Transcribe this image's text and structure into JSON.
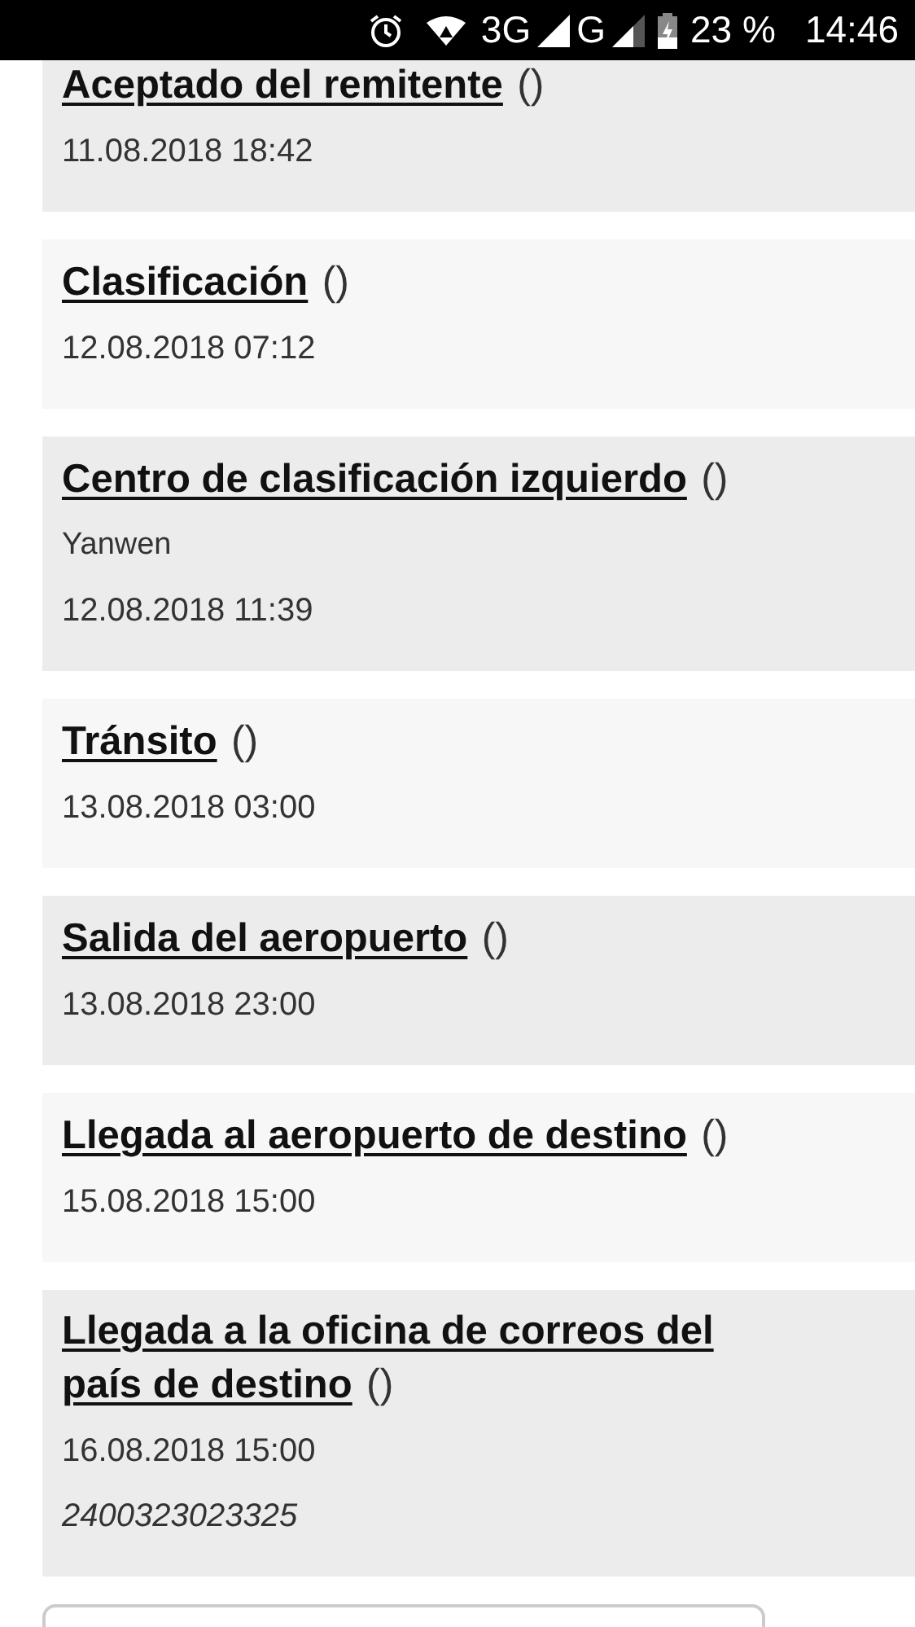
{
  "status_bar": {
    "network_3g": "3G",
    "network_g": "G",
    "battery": "23 %",
    "time": "14:46"
  },
  "events": [
    {
      "title": "Aceptado del remitente",
      "suffix": "()",
      "date": "11.08.2018 18:42"
    },
    {
      "title": "Clasificación",
      "suffix": "()",
      "date": "12.08.2018 07:12"
    },
    {
      "title": "Centro de clasificación izquierdo",
      "suffix": "()",
      "location": "Yanwen",
      "date": "12.08.2018 11:39"
    },
    {
      "title": "Tránsito",
      "suffix": "()",
      "date": "13.08.2018 03:00"
    },
    {
      "title": "Salida del aeropuerto",
      "suffix": "()",
      "date": "13.08.2018 23:00"
    },
    {
      "title": "Llegada al aeropuerto de destino",
      "suffix": "()",
      "date": "15.08.2018 15:00"
    },
    {
      "title": "Llegada a la oficina de correos del país de destino",
      "suffix": "()",
      "date": "16.08.2018 15:00",
      "note": "2400323023325"
    }
  ]
}
